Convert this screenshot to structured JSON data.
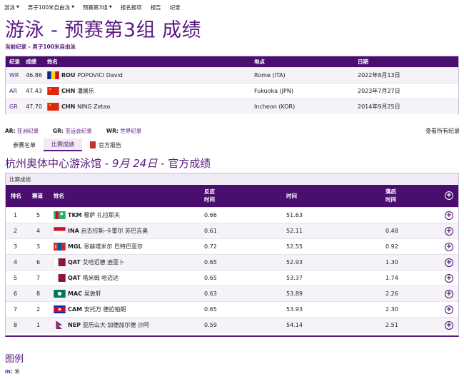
{
  "nav": {
    "items": [
      "游泳",
      "男子100米自由泳",
      "预赛第3组",
      "报名报项",
      "报告",
      "纪录"
    ],
    "has_caret": [
      true,
      true,
      true,
      false,
      false,
      false
    ]
  },
  "title": "游泳 - 预赛第3组 成绩",
  "current_record_label": "当前纪录 - 男子100米自由泳",
  "records": {
    "headers": [
      "纪录",
      "成绩",
      "姓名",
      "地点",
      "日期"
    ],
    "rows": [
      {
        "type": "WR",
        "result": "46.86",
        "noc": "ROU",
        "name": "POPOVICI David",
        "place": "Rome (ITA)",
        "date": "2022年8月13日",
        "flag": "ROU"
      },
      {
        "type": "AR",
        "result": "47.43",
        "noc": "CHN",
        "name": "潘展乐",
        "place": "Fukuoka (JPN)",
        "date": "2023年7月27日",
        "flag": "CHN"
      },
      {
        "type": "GR",
        "result": "47.70",
        "noc": "CHN",
        "name": "NING Zetao",
        "place": "Incheon (KOR)",
        "date": "2014年9月25日",
        "flag": "CHN"
      }
    ]
  },
  "abbr": [
    {
      "code": "AR:",
      "label": "亚洲纪录"
    },
    {
      "code": "GR:",
      "label": "亚运会纪录"
    },
    {
      "code": "WR:",
      "label": "世界纪录"
    }
  ],
  "all_records_link": "查看所有纪录",
  "tabs": [
    {
      "label": "参赛名单",
      "active": false
    },
    {
      "label": "比赛成绩",
      "active": true
    },
    {
      "label": "官方报告",
      "active": false,
      "icon": "pdf-icon"
    }
  ],
  "venue": {
    "name": "杭州奥体中心游泳馆 - ",
    "date": "9月 24日",
    "suffix": " - 官方成绩"
  },
  "results_label": "比赛成绩",
  "results": {
    "headers": {
      "rank": "排名",
      "lane": "赛道",
      "name": "姓名",
      "rt1": "反应",
      "rt2": "时间",
      "time": "时间",
      "behind1": "落后",
      "behind2": "时间"
    },
    "rows": [
      {
        "rank": "1",
        "lane": "5",
        "noc": "TKM",
        "name": "穆萨 扎拉耶夫",
        "rt": "0.66",
        "time": "51.63",
        "behind": "",
        "flag": "TKM"
      },
      {
        "rank": "2",
        "lane": "4",
        "noc": "INA",
        "name": "启古拉斯-卡雷尔 苏巴吉奥",
        "rt": "0.61",
        "time": "52.11",
        "behind": "0.48",
        "flag": "INA"
      },
      {
        "rank": "3",
        "lane": "3",
        "noc": "MGL",
        "name": "恩赫塔米尔 巴特巴亚尔",
        "rt": "0.72",
        "time": "52.55",
        "behind": "0.92",
        "flag": "MGL"
      },
      {
        "rank": "4",
        "lane": "6",
        "noc": "QAT",
        "name": "艾哈迈德 迪亚卜",
        "rt": "0.65",
        "time": "52.93",
        "behind": "1.30",
        "flag": "QAT"
      },
      {
        "rank": "5",
        "lane": "7",
        "noc": "QAT",
        "name": "塔米姆 哈迈达",
        "rt": "0.65",
        "time": "53.37",
        "behind": "1.74",
        "flag": "QAT"
      },
      {
        "rank": "6",
        "lane": "8",
        "noc": "MAC",
        "name": "吴敦轩",
        "rt": "0.63",
        "time": "53.89",
        "behind": "2.26",
        "flag": "MAC"
      },
      {
        "rank": "7",
        "lane": "2",
        "noc": "CAM",
        "name": "安托万 德拉帕朗",
        "rt": "0.65",
        "time": "53.93",
        "behind": "2.30",
        "flag": "CAM"
      },
      {
        "rank": "8",
        "lane": "1",
        "noc": "NEP",
        "name": "亚历山大·加德加尔德 沙阿",
        "rt": "0.59",
        "time": "54.14",
        "behind": "2.51",
        "flag": "NEP"
      }
    ]
  },
  "legend": {
    "title": "图例",
    "code": "m:",
    "label": "米"
  },
  "colors": {
    "accent": "#5b1a82",
    "header_bg": "#4a0f6e",
    "row_alt": "#f5f3f7"
  }
}
